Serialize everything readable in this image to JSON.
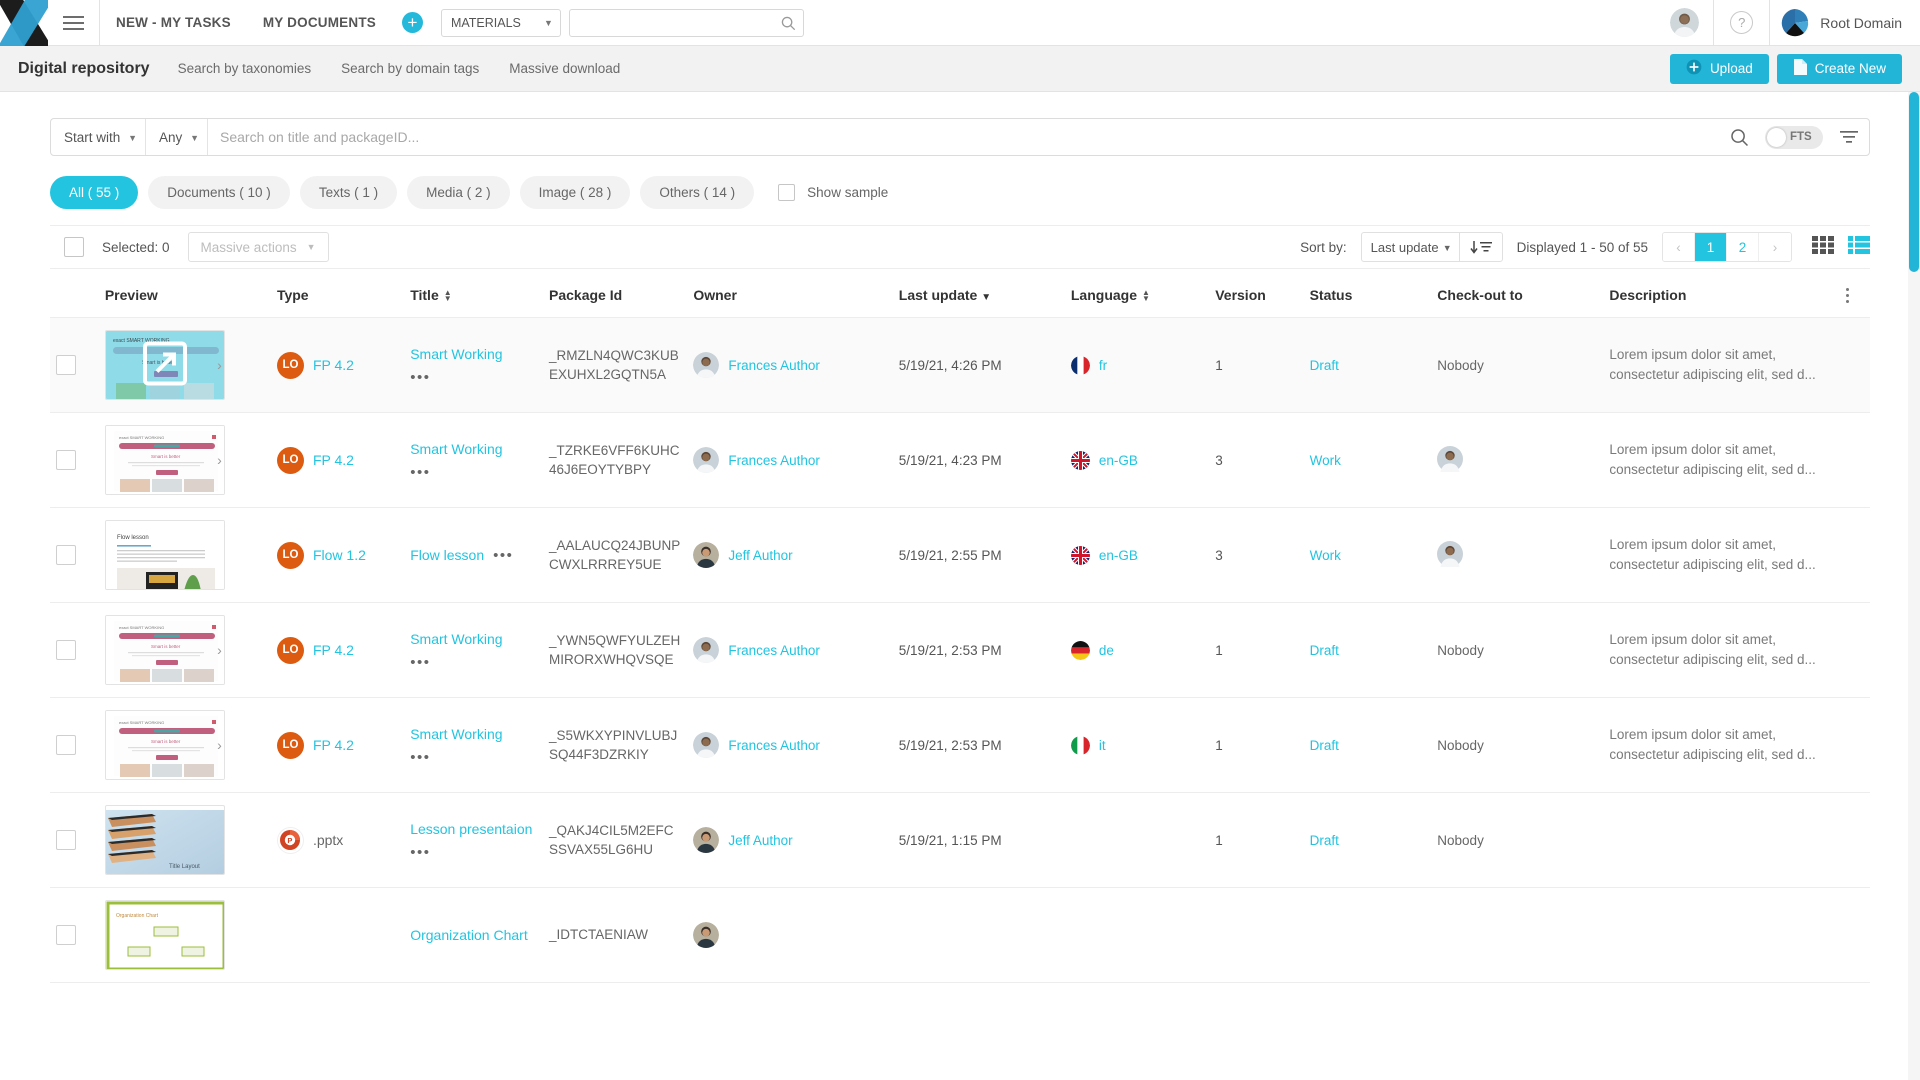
{
  "topbar": {
    "nav": [
      {
        "label": "NEW - MY TASKS",
        "name": "nav-new-my-tasks"
      },
      {
        "label": "MY DOCUMENTS",
        "name": "nav-my-documents"
      }
    ],
    "add_label": "+",
    "materials_select": "MATERIALS",
    "search_placeholder": "",
    "search_value": "",
    "help_label": "?",
    "domain_label": "Root Domain"
  },
  "subheader": {
    "title": "Digital repository",
    "links": [
      "Search by taxonomies",
      "Search by domain tags",
      "Massive download"
    ],
    "upload_label": "Upload",
    "create_label": "Create New"
  },
  "search": {
    "match_mode": "Start with",
    "scope": "Any",
    "placeholder": "Search on title and packageID...",
    "value": "",
    "fts_label": "FTS",
    "fts_on": false
  },
  "chips": [
    {
      "label": "All ( 55 )",
      "active": true
    },
    {
      "label": "Documents ( 10 )",
      "active": false
    },
    {
      "label": "Texts ( 1 )",
      "active": false
    },
    {
      "label": "Media ( 2 )",
      "active": false
    },
    {
      "label": "Image ( 28 )",
      "active": false
    },
    {
      "label": "Others ( 14 )",
      "active": false
    }
  ],
  "show_sample_label": "Show sample",
  "toolbar": {
    "selected_label": "Selected: 0",
    "massive_actions_label": "Massive actions",
    "sort_by_label": "Sort by:",
    "sort_value": "Last update",
    "displayed_label": "Displayed 1 - 50 of 55",
    "pages": [
      "1",
      "2"
    ],
    "current_page": "1",
    "prev_label": "‹",
    "next_label": "›"
  },
  "table": {
    "columns": [
      "Preview",
      "Type",
      "Title",
      "Package Id",
      "Owner",
      "Last update",
      "Language",
      "Version",
      "Status",
      "Check-out to",
      "Description"
    ],
    "rows": [
      {
        "thumb": "smart-working-hero",
        "type_badge": "LO",
        "type": "FP 4.2",
        "title": "Smart Working",
        "title_inline": false,
        "package_id": "_RMZLN4QWC3KUBEXUHXL2GQTN5A",
        "owner": "Frances Author",
        "owner_avatar": "frances",
        "last_update": "5/19/21, 4:26 PM",
        "lang": "fr",
        "flag": "fr",
        "version": "1",
        "status": "Draft",
        "checkout": "Nobody",
        "checkout_avatar": "",
        "description": "Lorem ipsum dolor sit amet, consectetur adipiscing elit, sed d...",
        "highlight": true
      },
      {
        "thumb": "smart-working-page",
        "type_badge": "LO",
        "type": "FP 4.2",
        "title": "Smart Working",
        "title_inline": false,
        "package_id": "_TZRKE6VFF6KUHC46J6EOYTYBPY",
        "owner": "Frances Author",
        "owner_avatar": "frances",
        "last_update": "5/19/21, 4:23 PM",
        "lang": "en-GB",
        "flag": "gb",
        "version": "3",
        "status": "Work",
        "checkout": "",
        "checkout_avatar": "frances",
        "description": "Lorem ipsum dolor sit amet, consectetur adipiscing elit, sed d...",
        "highlight": false
      },
      {
        "thumb": "flow-lesson",
        "type_badge": "LO",
        "type": "Flow 1.2",
        "title": "Flow lesson",
        "title_inline": true,
        "package_id": "_AALAUCQ24JBUNPCWXLRRREY5UE",
        "owner": "Jeff Author",
        "owner_avatar": "jeff",
        "last_update": "5/19/21, 2:55 PM",
        "lang": "en-GB",
        "flag": "gb",
        "version": "3",
        "status": "Work",
        "checkout": "",
        "checkout_avatar": "frances",
        "description": "Lorem ipsum dolor sit amet, consectetur adipiscing elit, sed d...",
        "highlight": false
      },
      {
        "thumb": "smart-working-page",
        "type_badge": "LO",
        "type": "FP 4.2",
        "title": "Smart Working",
        "title_inline": false,
        "package_id": "_YWN5QWFYULZEHMIRORXWHQVSQE",
        "owner": "Frances Author",
        "owner_avatar": "frances",
        "last_update": "5/19/21, 2:53 PM",
        "lang": "de",
        "flag": "de",
        "version": "1",
        "status": "Draft",
        "checkout": "Nobody",
        "checkout_avatar": "",
        "description": "Lorem ipsum dolor sit amet, consectetur adipiscing elit, sed d...",
        "highlight": false
      },
      {
        "thumb": "smart-working-page",
        "type_badge": "LO",
        "type": "FP 4.2",
        "title": "Smart Working",
        "title_inline": false,
        "package_id": "_S5WKXYPINVLUBJSQ44F3DZRKIY",
        "owner": "Frances Author",
        "owner_avatar": "frances",
        "last_update": "5/19/21, 2:53 PM",
        "lang": "it",
        "flag": "it",
        "version": "1",
        "status": "Draft",
        "checkout": "Nobody",
        "checkout_avatar": "",
        "description": "Lorem ipsum dolor sit amet, consectetur adipiscing elit, sed d...",
        "highlight": false
      },
      {
        "thumb": "title-layout",
        "type_badge": "PPT",
        "type": ".pptx",
        "title": "Lesson presentaion",
        "title_inline": false,
        "package_id": "_QAKJ4CIL5M2EFCSSVAX55LG6HU",
        "owner": "Jeff Author",
        "owner_avatar": "jeff",
        "last_update": "5/19/21, 1:15 PM",
        "lang": "",
        "flag": "",
        "version": "1",
        "status": "Draft",
        "checkout": "Nobody",
        "checkout_avatar": "",
        "description": "",
        "highlight": false
      },
      {
        "thumb": "org-chart",
        "type_badge": "",
        "type": "",
        "title": "Organization Chart",
        "title_inline": false,
        "package_id": "_IDTCTAENIAW",
        "owner": "",
        "owner_avatar": "jeff",
        "last_update": "",
        "lang": "",
        "flag": "",
        "version": "",
        "status": "",
        "checkout": "",
        "checkout_avatar": "",
        "description": "",
        "highlight": false
      }
    ]
  },
  "colors": {
    "accent": "#23c4e0",
    "badge_orange": "#dd5b10",
    "subheader_bg": "#f2f2f2"
  }
}
